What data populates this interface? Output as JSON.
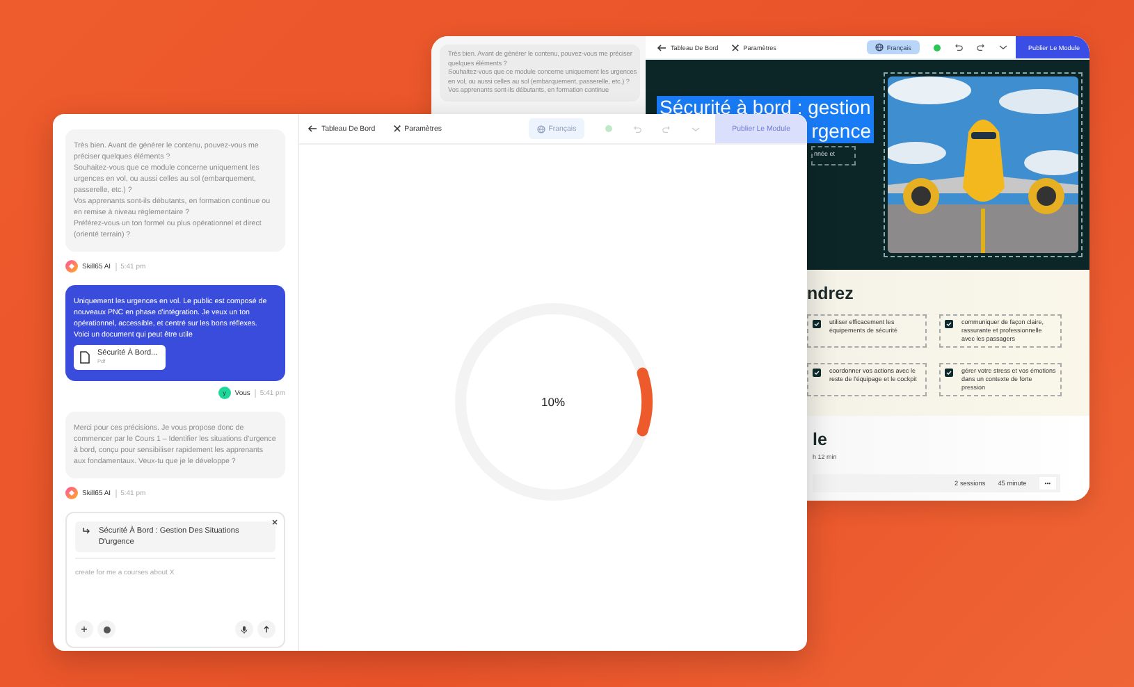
{
  "back_window": {
    "chat_message": "Très bien. Avant de générer le contenu, pouvez-vous me préciser quelques éléments ?\nSouhaitez-vous que ce module concerne uniquement les urgences en vol, ou aussi celles au sol (embarquement, passerelle, etc.) ?\nVos apprenants sont-ils débutants, en formation continue",
    "toolbar": {
      "back_label": "Tableau De Bord",
      "settings_label": "Paramètres",
      "language": "Français",
      "publish": "Publier Le Module",
      "disabled": false
    },
    "canvas": {
      "title": "Sécurité à bord : gestion",
      "title_continued": "rgence",
      "subtitle_fragment": "nnée et",
      "objectives_heading": "ndrez",
      "objectives": [
        {
          "text": "utiliser efficacement les équipements de sécurité",
          "checked": true
        },
        {
          "text": "communiquer de façon claire, rassurante et professionnelle avec les passagers",
          "checked": true
        },
        {
          "text": "coordonner vos actions avec le reste de l'équipage et le cockpit",
          "checked": true
        },
        {
          "text": "gérer votre stress et vos émotions dans un contexte de forte pression",
          "checked": true
        }
      ],
      "section_heading": "le",
      "duration": "h 12 min",
      "sessions": "2 sessions",
      "minutes": "45 minute",
      "more": "•••"
    }
  },
  "front_window": {
    "messages": [
      {
        "kind": "assistant",
        "text": "Très bien. Avant de générer le contenu, pouvez-vous me préciser quelques éléments ?\nSouhaitez-vous que ce module concerne uniquement les urgences en vol, ou aussi celles au sol (embarquement, passerelle, etc.) ?\nVos apprenants sont-ils débutants, en formation continue ou en remise à niveau réglementaire ?\nPréférez-vous un ton formel ou plus opérationnel et direct (orienté terrain) ?",
        "sender": "Skill65 AI",
        "time": "5:41 pm"
      },
      {
        "kind": "user",
        "text": "Uniquement les urgences en vol. Le public est composé de nouveaux PNC en phase d'intégration. Je veux un ton opérationnel, accessible, et centré sur les bons réflexes.\nVoici un document qui peut être utile",
        "attachment": {
          "name": "Sécurité À Bord...",
          "type": "Pdf"
        },
        "avatar": "y",
        "sender": "Vous",
        "time": "5:41 pm"
      },
      {
        "kind": "assistant",
        "text": "Merci pour ces précisions. Je vous propose donc de commencer par le Cours 1 – Identifier les situations d'urgence à bord, conçu pour sensibiliser rapidement les apprenants aux fondamentaux. Veux-tu que je le développe ?",
        "sender": "Skill65 AI",
        "time": "5:41 pm"
      }
    ],
    "composer": {
      "reference": "Sécurité À Bord : Gestion Des Situations D'urgence",
      "placeholder": "create for me a courses about X"
    },
    "toolbar": {
      "back_label": "Tableau De Bord",
      "settings_label": "Paramètres",
      "language": "Français",
      "publish": "Publier Le Module",
      "disabled": true
    },
    "progress": {
      "level": 0.1,
      "label": "10%"
    }
  }
}
